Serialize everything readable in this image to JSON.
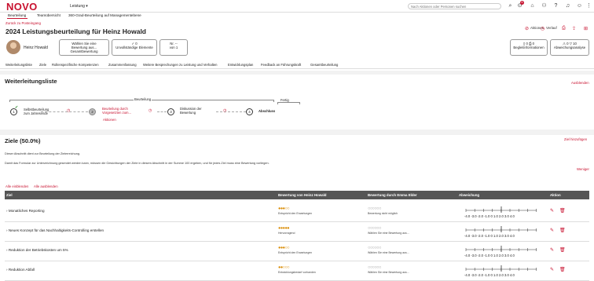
{
  "app": {
    "logo": "NOVO",
    "module": "Leistung ▾",
    "search_placeholder": "Nach Aktionen oder Personen suchen",
    "notification_count": "6"
  },
  "topnav": {
    "items": [
      "Beurteilung",
      "Teamübersicht",
      "360-Grad-Beurteilung auf Managementebene"
    ]
  },
  "page": {
    "back": "Zurück zu Posteingang",
    "title": "2024 Leistungsbeurteilung für Heinz Howald",
    "actions": [
      "Aktionen",
      "Verlauf"
    ],
    "employee": "Heinz Howald"
  },
  "cards": [
    {
      "line1": "Wählen Sie eine",
      "line2": "Bewertung aus...",
      "line3": "Gesamtbewertung"
    },
    {
      "line1": "✓ 0",
      "line2": "Unvollständige Elemente",
      "line3": ""
    },
    {
      "line1": "Nr. --",
      "line2": "von 1",
      "line3": ""
    },
    {
      "line1": "▯ 0  ⎙ 0",
      "line2": "Begleitinformationen",
      "line3": ""
    },
    {
      "line1": "⚠ 0  ▽ 10",
      "line2": "Abweichungsanalyse",
      "line3": ""
    }
  ],
  "subnav": [
    "Weiterleitungsliste",
    "Ziele",
    "Rollenspezifische Kompetenzen",
    "Zusammenfassung",
    "Weitere Besprechungen zu Leistung und Verhalten",
    "Entwicklungsplan",
    "Feedback an Führungskraft",
    "Gesamtbeurteilung"
  ],
  "routing": {
    "title": "Weiterleitungsliste",
    "hide": "Ausblenden",
    "bracket_label": "Beurteilung",
    "bracket2_label": "Fertig",
    "steps": [
      {
        "num": "1",
        "label": "Selbstbeurteilung zum Jahresende"
      },
      {
        "num": "2",
        "label": "Beurteilung durch Vorgesetzten zum..."
      },
      {
        "num": "3",
        "label": "Diskussion der Bewertung"
      },
      {
        "num": "4",
        "label": "Abschluss"
      }
    ],
    "current_link": "Aktionen"
  },
  "goals": {
    "title": "Ziele (50.0%)",
    "add": "Ziel hinzufügen",
    "text1": "Dieser Abschnitt dient zur Beurteilung der Zielerreichung.",
    "text2": "Damit das Formular zur Unterzeichnung gesendet werden kann, müssen die Gewichtungen der Ziele in diesem Abschnitt in der Summe 100 ergeben, und für jedes Ziel muss eine Bewertung vorliegen.",
    "less": "Weniger",
    "expand_all": "Alle einblenden",
    "collapse_all": "Alle ausblenden",
    "columns": [
      "Ziel",
      "Bewertung von Heinz Howald",
      "Bewertung durch Emma Elder",
      "Abweichung",
      "Aktion"
    ],
    "scale_labels": "-4.0 -3.0 -2.0 -1.0 0 1.0 2.0 3.0 4.0",
    "rows": [
      {
        "goal": "Monatliches Reporting",
        "self_label": "Entspricht den Erwartungen",
        "mgr_label": "Bewertung nicht möglich",
        "self_filled": 3
      },
      {
        "goal": "Neues Konzept für das Nachhaltigkeits-Controlling erstellen",
        "self_label": "Hervorragend",
        "mgr_label": "Wählen Sie eine Bewertung aus...",
        "self_filled": 5
      },
      {
        "goal": "Reduktion der Betriebskosten um 5%",
        "self_label": "Entspricht den Erwartungen",
        "mgr_label": "Wählen Sie eine Bewertung aus...",
        "self_filled": 3
      },
      {
        "goal": "Reduktion Abfall",
        "self_label": "Entwicklungsbedarf vorhanden",
        "mgr_label": "Wählen Sie eine Bewertung aus...",
        "self_filled": 2
      }
    ]
  },
  "colors": {
    "accent": "#c8102e",
    "header_bg": "#555555",
    "dot_fill": "#d98a00"
  }
}
